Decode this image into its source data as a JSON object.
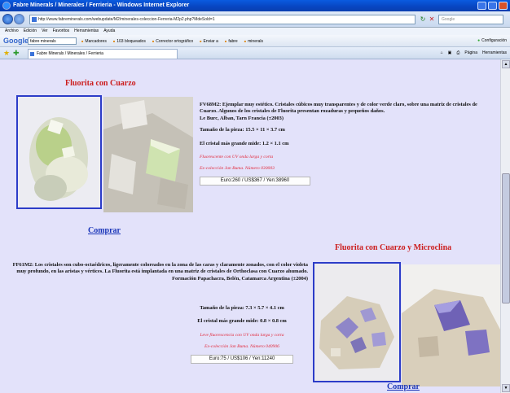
{
  "window": {
    "title": "Fabre Minerals / Minerales / Ferrieria - Windows Internet Explorer"
  },
  "address": {
    "url": "http://www.fabreminerals.com/webupdate/M2/minerales-coleccion-Ferreria-M2p2.php?MdeSold=1",
    "search_placeholder": "Google"
  },
  "menu": [
    "Archivo",
    "Edición",
    "Ver",
    "Favoritos",
    "Herramientas",
    "Ayuda"
  ],
  "google_toolbar": {
    "logo": "Google",
    "search_value": "fabre minerals",
    "items": [
      "Marcadores",
      "103 bloqueados",
      "Corrector ortográfico",
      "Enviar a",
      "fabre",
      "minerals"
    ],
    "config": "Configuración"
  },
  "tab": {
    "label": "Fabre Minerals / Minerales / Ferrieria",
    "tools": [
      "Página",
      "Herramientas"
    ]
  },
  "specimens": [
    {
      "title": "Fluorita con Cuarzo",
      "lines": [
        "FV68M2: Ejemplar muy estético. Cristales cúbicos muy transparentes y de color verde claro, sobre una matriz de cristales de Cuarzo. Algunos de los cristales de Fluorita presentan rozaduras y pequeños daños.",
        "Le Burc, Alban, Tarn  Francia (±2003)",
        "Tamaño de la pieza: 15.5 × 11 × 3.7 cm",
        "El cristal más grande mide: 1.2 × 1.1 cm",
        "Fluorescente con UV onda larga y corta",
        "Ex-colección Jan Buma. Número 030003"
      ],
      "price": "Euro:260 / US$367 / Yen:38960",
      "buy": "Comprar"
    },
    {
      "title": "Fluorita con Cuarzo y Microclina",
      "lines": [
        "FF61M2: Los cristales son cubo-octaédricos, ligeramente coloreados en la zona de las caras y claramente zonados, con el color violeta muy profundo, en las aristas y vértices. La Fluorita está implantada en una matriz de cristales de Orthoclasa con Cuarzo ahumado.",
        "Formación Papachacra, Belén, Catamarca  Argentina (±2004)",
        "Tamaño de la pieza: 7.3 × 5.7 × 4.1 cm",
        "El cristal más grande mide: 0.8 × 0.8 cm",
        "Leve fluorescencia con UV onda larga y corta",
        "Ex-colección Jan Buma. Número 040906"
      ],
      "price": "Euro:75 / US$106 / Yen:11240",
      "buy": "Comprar"
    }
  ]
}
